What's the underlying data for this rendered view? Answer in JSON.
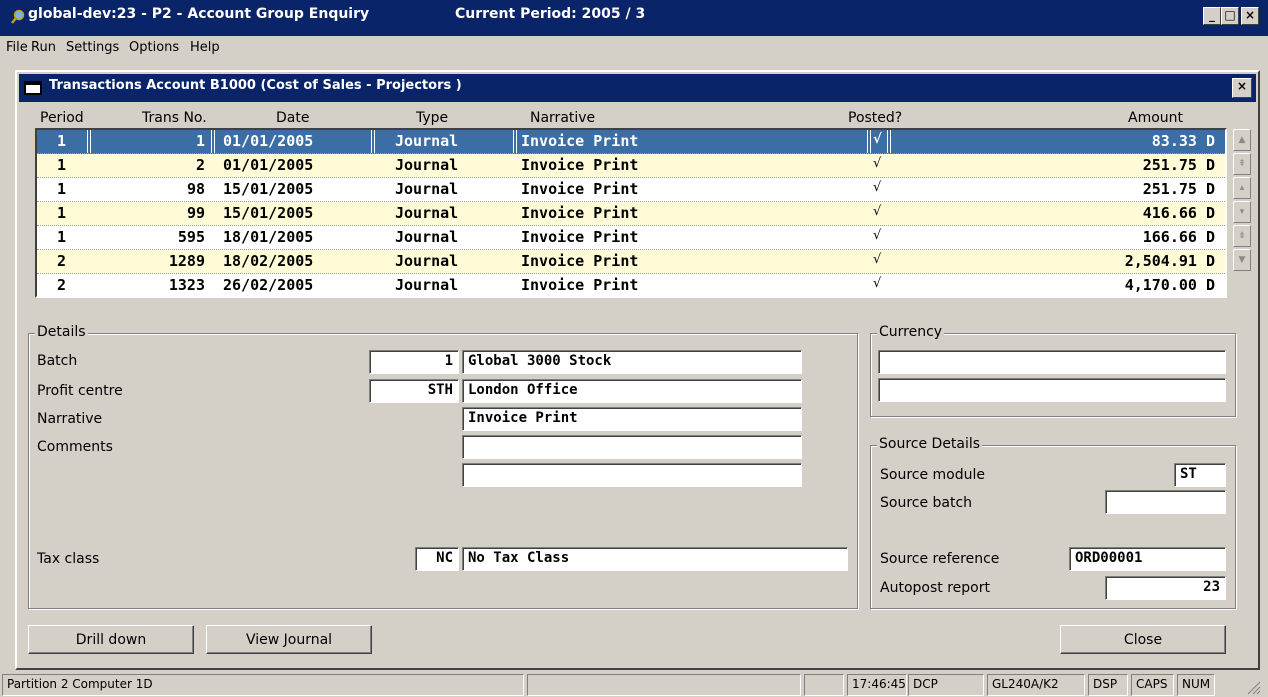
{
  "app": {
    "title": "global-dev:23 - P2 - Account Group Enquiry",
    "period": "Current Period: 2005   / 3",
    "minimize": "_",
    "maximize": "□",
    "close": "×"
  },
  "menu": [
    "File",
    "Run",
    "Settings",
    "Options",
    "Help"
  ],
  "dialog": {
    "title": "Transactions Account B1000     (Cost of Sales - Projectors   )",
    "close": "×"
  },
  "table": {
    "headers": [
      "Period",
      "Trans No.",
      "Date",
      "Type",
      "Narrative",
      "Posted?",
      "Amount"
    ],
    "rows": [
      {
        "period": "1",
        "trans": "1",
        "date": "01/01/2005",
        "type": "Journal",
        "narrative": "Invoice Print",
        "posted": "√",
        "amount": "83.33 D"
      },
      {
        "period": "1",
        "trans": "2",
        "date": "01/01/2005",
        "type": "Journal",
        "narrative": "Invoice Print",
        "posted": "√",
        "amount": "251.75 D"
      },
      {
        "period": "1",
        "trans": "98",
        "date": "15/01/2005",
        "type": "Journal",
        "narrative": "Invoice Print",
        "posted": "√",
        "amount": "251.75 D"
      },
      {
        "period": "1",
        "trans": "99",
        "date": "15/01/2005",
        "type": "Journal",
        "narrative": "Invoice Print",
        "posted": "√",
        "amount": "416.66 D"
      },
      {
        "period": "1",
        "trans": "595",
        "date": "18/01/2005",
        "type": "Journal",
        "narrative": "Invoice Print",
        "posted": "√",
        "amount": "166.66 D"
      },
      {
        "period": "2",
        "trans": "1289",
        "date": "18/02/2005",
        "type": "Journal",
        "narrative": "Invoice Print",
        "posted": "√",
        "amount": "2,504.91 D"
      },
      {
        "period": "2",
        "trans": "1323",
        "date": "26/02/2005",
        "type": "Journal",
        "narrative": "Invoice Print",
        "posted": "√",
        "amount": "4,170.00 D"
      }
    ]
  },
  "details": {
    "legend": "Details",
    "batch_label": "Batch",
    "batch_no": "1",
    "batch_name": "Global 3000 Stock",
    "profit_label": "Profit centre",
    "profit_code": "STH",
    "profit_name": "London Office",
    "narrative_label": "Narrative",
    "narrative_value": "Invoice Print",
    "comments_label": "Comments",
    "comments_1": "",
    "comments_2": "",
    "tax_label": "Tax class",
    "tax_code": "NC",
    "tax_name": "No Tax Class"
  },
  "currency": {
    "legend": "Currency",
    "line_1": "",
    "line_2": ""
  },
  "source": {
    "legend": "Source Details",
    "module_label": "Source module",
    "module_value": "ST",
    "batch_label": "Source batch",
    "batch_value": "",
    "reference_label": "Source reference",
    "reference_value": "ORD00001",
    "autopost_label": "Autopost report",
    "autopost_value": "23"
  },
  "buttons": {
    "drill_down": "Drill down",
    "view_journal": "View Journal",
    "close": "Close"
  },
  "statusbar": {
    "partition": "Partition 2 Computer 1D",
    "time": "17:46:45",
    "mode": "DCP",
    "program": "GL240A/K2",
    "dsp": "DSP",
    "caps": "CAPS",
    "num": "NUM"
  }
}
